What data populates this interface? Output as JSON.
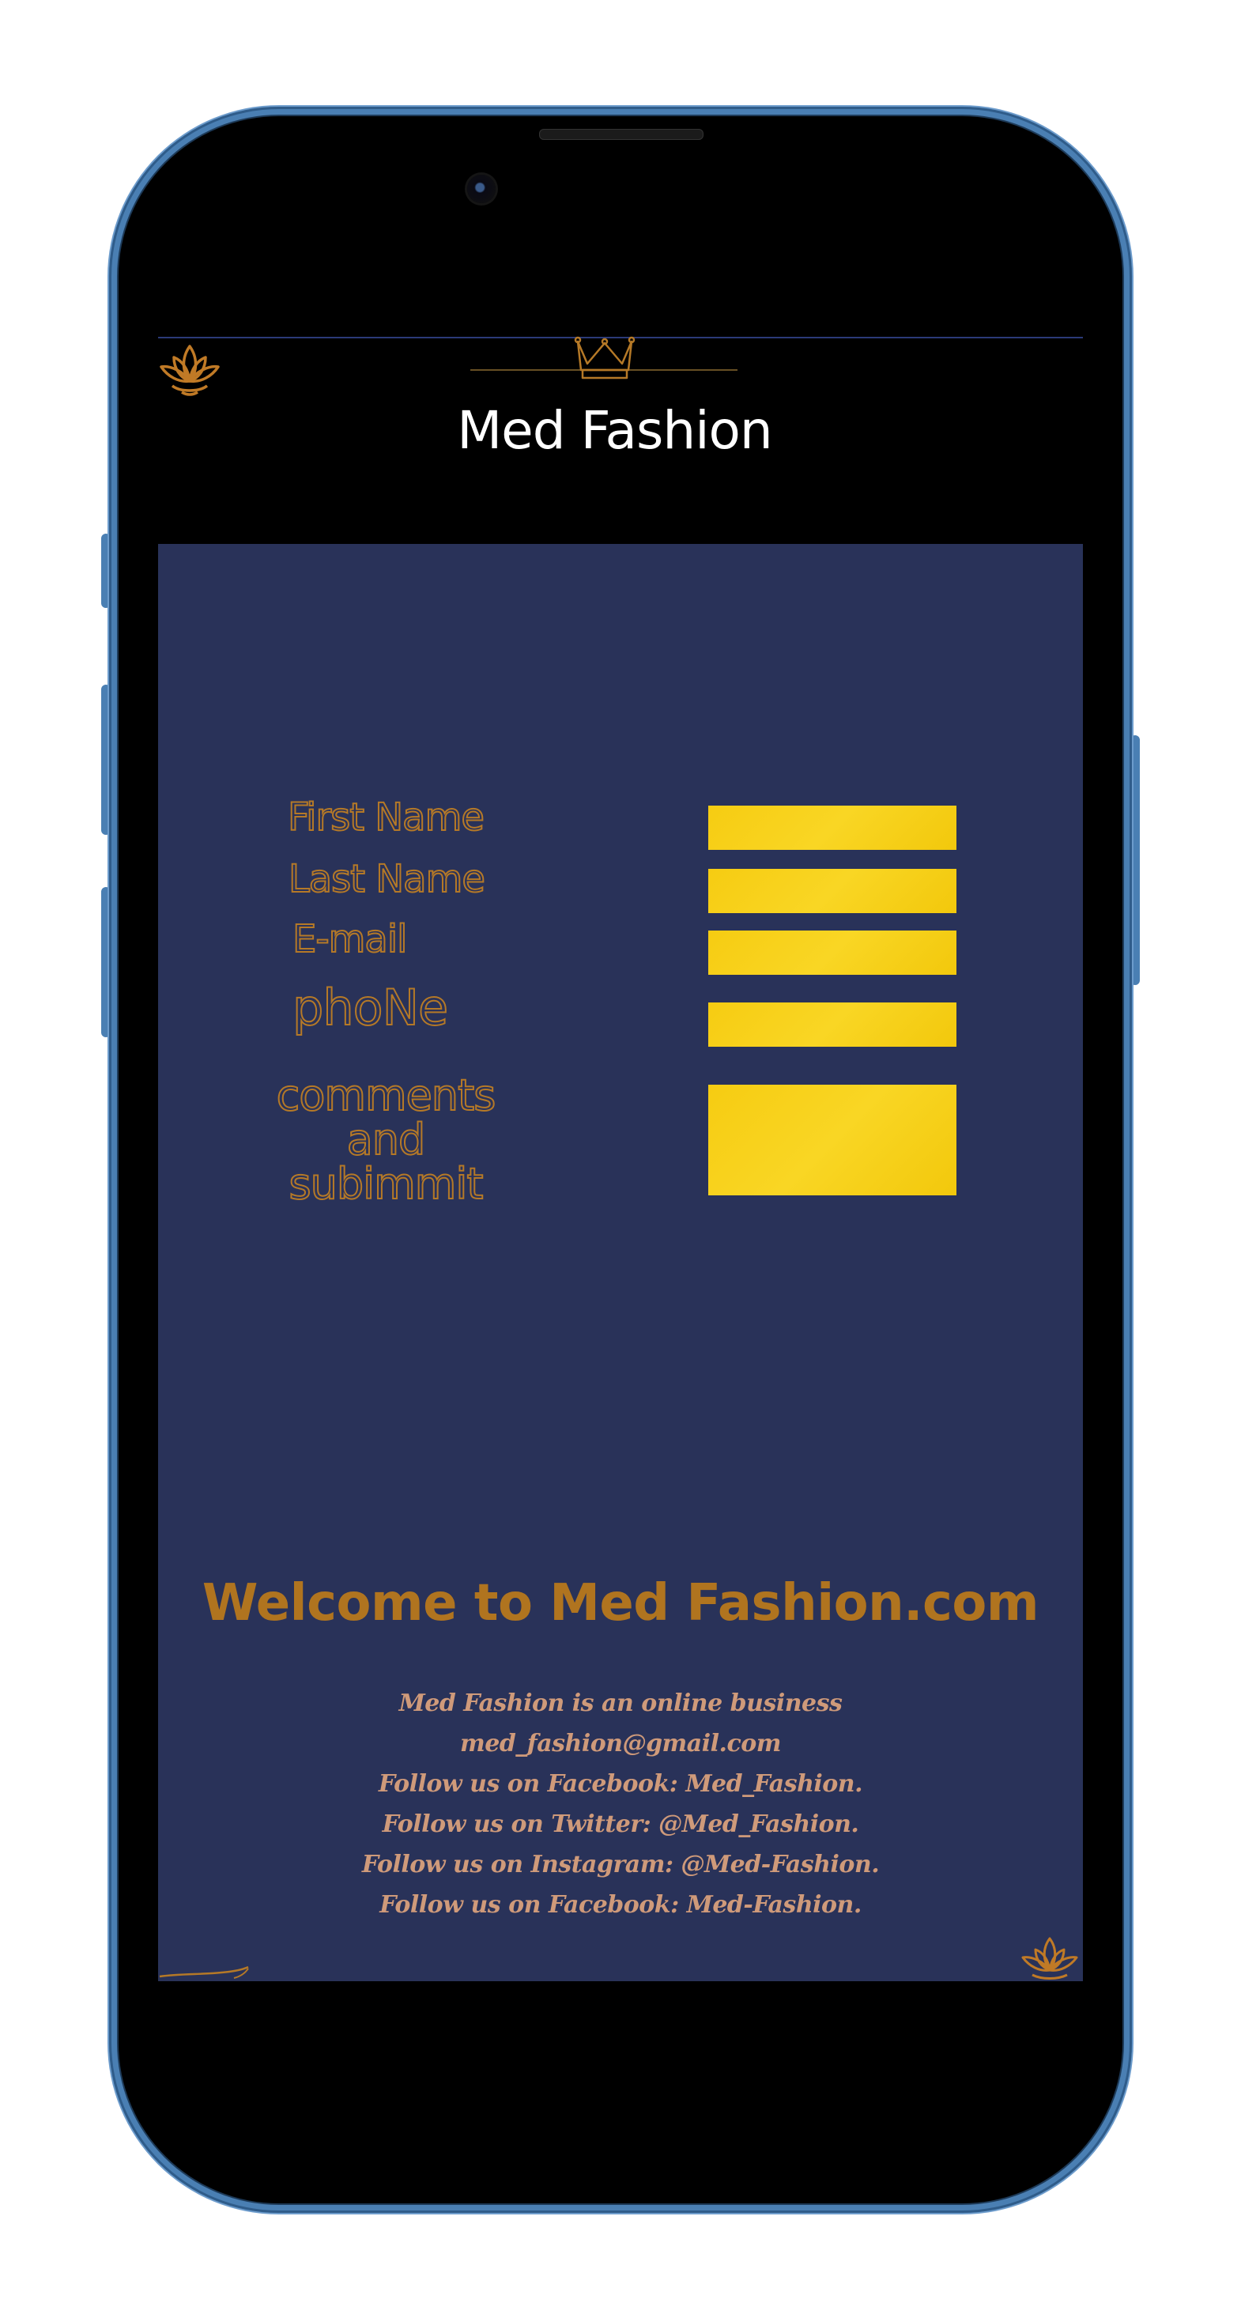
{
  "app": {
    "title": "Med Fashion"
  },
  "form": {
    "fields": [
      {
        "label": "First Name"
      },
      {
        "label": "Last Name"
      },
      {
        "label": "E-mail"
      },
      {
        "label": "phoNe"
      },
      {
        "label": "comments and subimmit"
      }
    ]
  },
  "footer": {
    "heading": "Welcome to Med Fashion.com",
    "lines": [
      "Med Fashion is an online business",
      "med_fashion@gmail.com",
      "Follow us on Facebook: Med_Fashion.",
      "Follow us on Twitter: @Med_Fashion.",
      "Follow us on Instagram: @Med-Fashion.",
      "Follow us on Facebook: Med-Fashion."
    ]
  },
  "icons": {
    "top_left": "lotus-icon",
    "top_center": "crown-icon",
    "bottom_right": "lotus-icon",
    "bottom_left": "swirl-ornament"
  },
  "colors": {
    "panel": "#293259",
    "accent_gold": "#b57927",
    "field_yellow": "#f8d21a",
    "screen_bg": "#000000",
    "phone_frame": "#4a7fb3"
  }
}
